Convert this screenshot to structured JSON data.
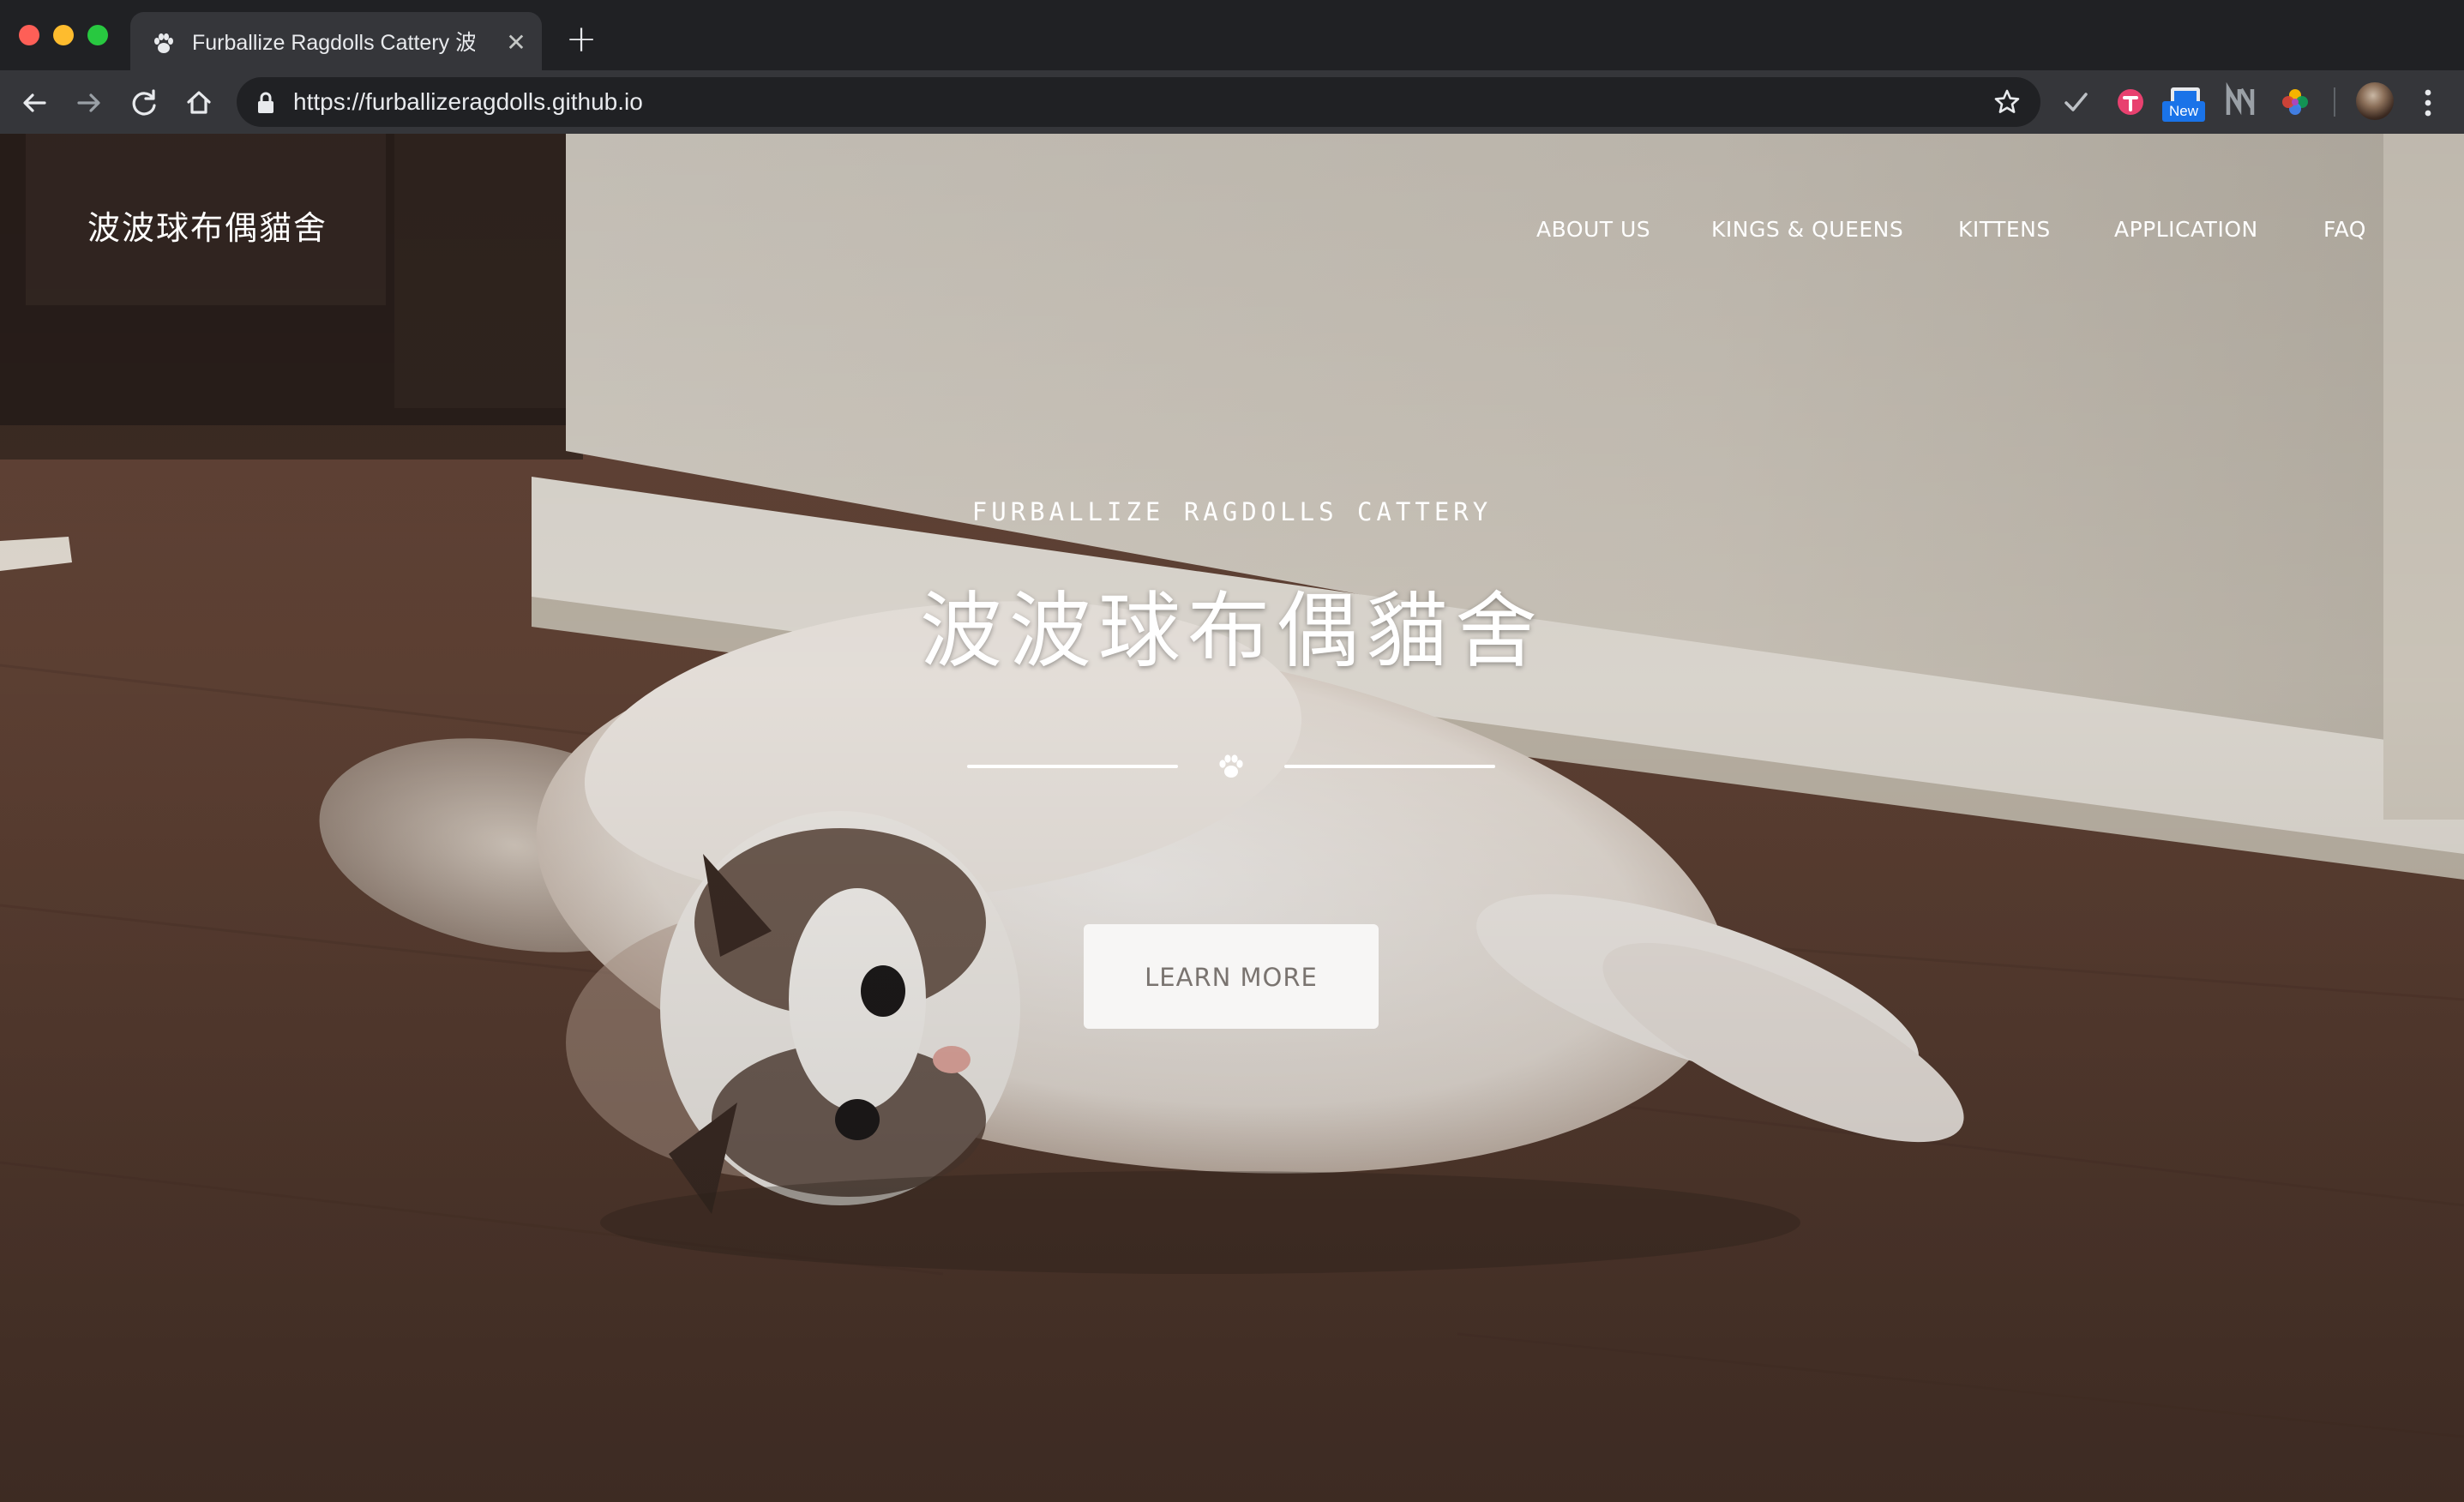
{
  "browser": {
    "tab": {
      "title": "Furballize Ragdolls Cattery 波波",
      "favicon": "paw-icon"
    },
    "url": "https://furballizeragdolls.github.io",
    "extensions": {
      "new_badge": "New"
    }
  },
  "site": {
    "brand": "波波球布偶貓舍",
    "nav": [
      {
        "label": "About Us"
      },
      {
        "label": "Kings & Queens"
      },
      {
        "label": "Kittens"
      },
      {
        "label": "Application"
      },
      {
        "label": "FAQ"
      }
    ],
    "hero": {
      "subtitle": "Furballize Ragdolls Cattery",
      "title": "波波球布偶貓舍",
      "button": "Learn More"
    }
  },
  "colors": {
    "chrome_dark": "#202124",
    "chrome_toolbar": "#35363a",
    "button_bg": "#f7f6f5",
    "button_text": "#7a7470"
  }
}
